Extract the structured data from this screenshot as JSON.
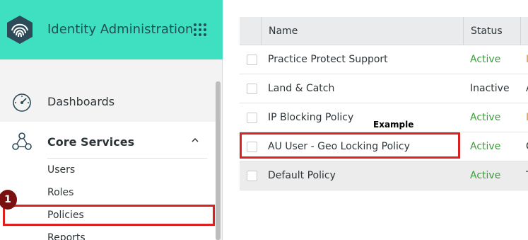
{
  "app": {
    "title": "Identity Administration"
  },
  "sidebar": {
    "nav": [
      {
        "label": "Dashboards",
        "icon": "gauge-icon"
      },
      {
        "label": "Core Services",
        "icon": "nodes-icon",
        "expanded": true,
        "children": [
          "Users",
          "Roles",
          "Policies",
          "Reports"
        ]
      }
    ]
  },
  "table": {
    "columns": [
      "Name",
      "Status"
    ],
    "rows": [
      {
        "name": "Practice Protect Support",
        "status": "Active",
        "extra": "I"
      },
      {
        "name": "Land & Catch",
        "status": "Inactive",
        "extra": "A"
      },
      {
        "name": "IP Blocking Policy",
        "status": "Active",
        "extra": "I"
      },
      {
        "name": "AU User - Geo Locking Policy",
        "status": "Active",
        "extra": "G"
      },
      {
        "name": "Default Policy",
        "status": "Active",
        "extra": "T"
      }
    ]
  },
  "annotations": {
    "badge_number": "1",
    "example_label": "Example"
  },
  "colors": {
    "header": "#3fe0c2",
    "highlight": "#dc1f1f",
    "active": "#3c9a3c",
    "badge": "#7a1010"
  }
}
